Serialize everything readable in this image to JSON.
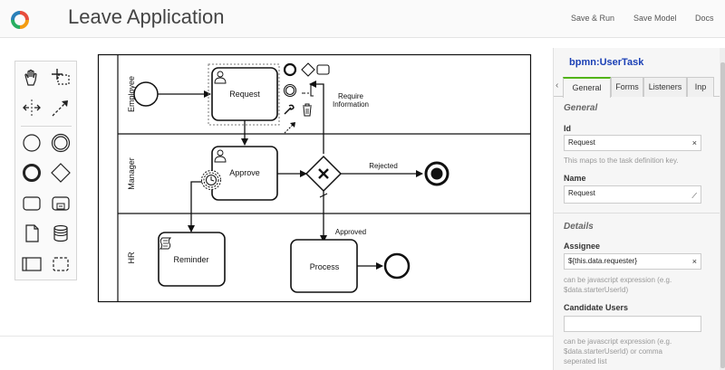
{
  "header": {
    "title": "Leave Application",
    "buttons": {
      "save_run": "Save & Run",
      "save_model": "Save Model",
      "docs": "Docs"
    }
  },
  "palette": {
    "tools": [
      "hand-tool",
      "lasso-tool",
      "space-tool",
      "global-connect-tool",
      "start-event",
      "intermediate-event",
      "end-event",
      "gateway",
      "task",
      "subprocess",
      "data-object",
      "data-store",
      "pool",
      "group"
    ]
  },
  "diagram": {
    "lanes": [
      "Employee",
      "Manager",
      "HR"
    ],
    "tasks": {
      "request": "Request",
      "approve": "Approve",
      "reminder": "Reminder",
      "process": "Process"
    },
    "flow_labels": {
      "require_line1": "Require",
      "require_line2": "Information",
      "rejected": "Rejected",
      "approved": "Approved"
    }
  },
  "properties": {
    "element_type": "bpmn:UserTask",
    "tabs": [
      "General",
      "Forms",
      "Listeners",
      "Inp"
    ],
    "active_tab": "General",
    "general": {
      "section": "General",
      "id_label": "Id",
      "id_value": "Request",
      "id_help": "This maps to the task definition key.",
      "name_label": "Name",
      "name_value": "Request"
    },
    "details": {
      "section": "Details",
      "assignee_label": "Assignee",
      "assignee_value": "${this.data.requester}",
      "assignee_help_1": "can be javascript expression (e.g.",
      "assignee_help_2": "$data.starterUserId)",
      "candidate_label": "Candidate Users",
      "candidate_value": "",
      "candidate_help_1": "can be javascript expression (e.g.",
      "candidate_help_2": "$data.starterUserId) or comma",
      "candidate_help_3": "seperated list"
    }
  }
}
